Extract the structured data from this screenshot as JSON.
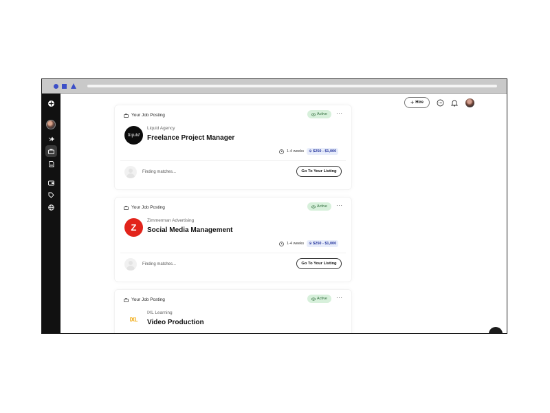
{
  "browser": {
    "accent": "#3c4fc7"
  },
  "sidebar": {
    "items": [
      {
        "icon": "logo-icon"
      },
      {
        "icon": "avatar"
      },
      {
        "icon": "sparkle-icon"
      },
      {
        "icon": "briefcase-icon",
        "active": true
      },
      {
        "icon": "document-icon"
      },
      {
        "icon": "wallet-icon"
      },
      {
        "icon": "tag-icon"
      },
      {
        "icon": "globe-icon"
      }
    ]
  },
  "topbar": {
    "hire_label": "Hire",
    "hire_icon": "plus-icon",
    "icons": [
      "chat-icon",
      "bell-icon",
      "user-avatar"
    ]
  },
  "cards": [
    {
      "header": "Your Job Posting",
      "status": "Active",
      "logo_text": "liquid",
      "company": "Liquid Agency",
      "title": "Freelance Project Manager",
      "duration": "1-4 weeks",
      "price": "$250 - $1,000",
      "matching": "Finding matches...",
      "cta": "Go To Your Listing"
    },
    {
      "header": "Your Job Posting",
      "status": "Active",
      "logo_text": "Z",
      "company": "Zimmerman Advertising",
      "title": "Social Media Management",
      "duration": "1-4 weeks",
      "price": "$250 - $1,000",
      "matching": "Finding matches...",
      "cta": "Go To Your Listing"
    },
    {
      "header": "Your Job Posting",
      "status": "Active",
      "logo_text": "IXL",
      "company": "IXL Learning",
      "title": "Video Production"
    }
  ],
  "colors": {
    "active_badge_bg": "#d7f0db",
    "active_badge_text": "#2f6b3b",
    "price_bg": "#e8edfb",
    "price_text": "#23349c"
  }
}
